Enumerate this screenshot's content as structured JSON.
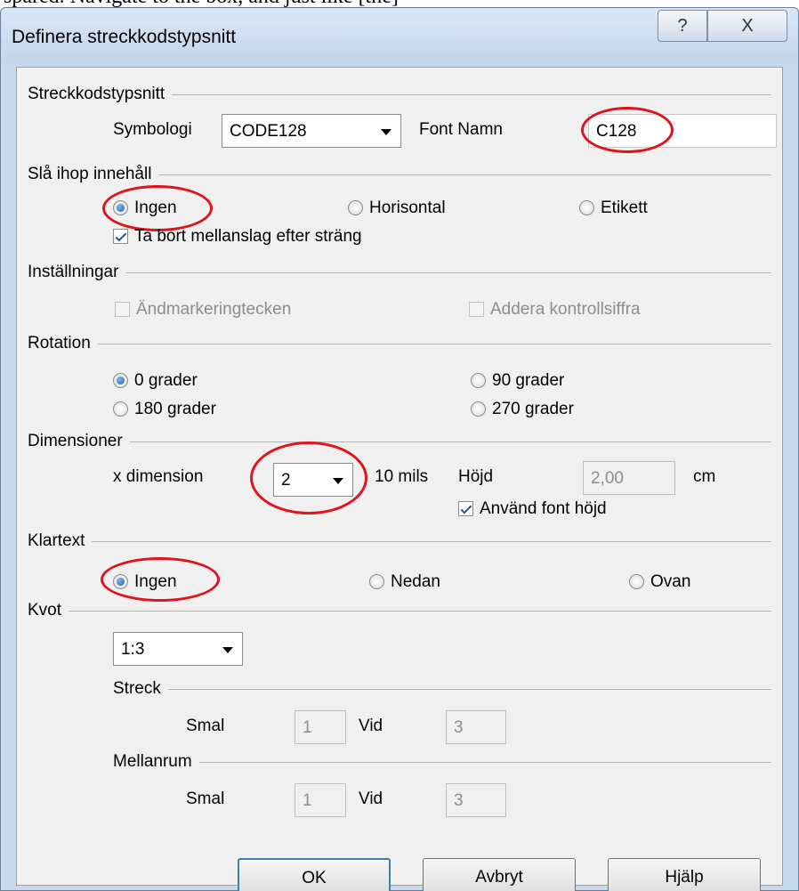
{
  "top_text": "spared. Navigate to the box, and just like [the]",
  "window": {
    "title": "Definera streckkodstypsnitt",
    "help_glyph": "?",
    "close_glyph": "X"
  },
  "barcode_font": {
    "group_label": "Streckkodstypsnitt",
    "symbology_label": "Symbologi",
    "symbology_value": "CODE128",
    "font_name_label": "Font Namn",
    "font_name_value": "C128"
  },
  "merge_content": {
    "group_label": "Slå ihop innehåll",
    "options": [
      "Ingen",
      "Horisontal",
      "Etikett"
    ],
    "selected": "Ingen",
    "remove_spaces_label": "Ta bort mellanslag efter sträng",
    "remove_spaces_checked": true
  },
  "settings": {
    "group_label": "Inställningar",
    "end_marker_label": "Ändmarkeringtecken",
    "end_marker_checked": false,
    "check_digit_label": "Addera kontrollsiffra",
    "check_digit_checked": false
  },
  "rotation": {
    "group_label": "Rotation",
    "options": [
      "0 grader",
      "90 grader",
      "180 grader",
      "270 grader"
    ],
    "selected": "0 grader"
  },
  "dimensions": {
    "group_label": "Dimensioner",
    "x_dimension_label": "x dimension",
    "x_dimension_value": "2",
    "x_dimension_unit": "10 mils",
    "height_label": "Höjd",
    "height_value": "2,00",
    "height_unit": "cm",
    "use_font_height_label": "Använd font höjd",
    "use_font_height_checked": true
  },
  "plain_text": {
    "group_label": "Klartext",
    "options": [
      "Ingen",
      "Nedan",
      "Ovan"
    ],
    "selected": "Ingen"
  },
  "ratio": {
    "group_label": "Kvot",
    "value": "1:3",
    "bar": {
      "group_label": "Streck",
      "narrow_label": "Smal",
      "narrow_value": "1",
      "wide_label": "Vid",
      "wide_value": "3"
    },
    "space": {
      "group_label": "Mellanrum",
      "narrow_label": "Smal",
      "narrow_value": "1",
      "wide_label": "Vid",
      "wide_value": "3"
    }
  },
  "buttons": {
    "ok": "OK",
    "cancel": "Avbryt",
    "help": "Hjälp"
  },
  "colors": {
    "highlight_ring": "#e0141c",
    "titlebar": "#c9d9ec",
    "dialog_bg": "#f0f0f0",
    "radio_fill": "#1f5fa8"
  }
}
